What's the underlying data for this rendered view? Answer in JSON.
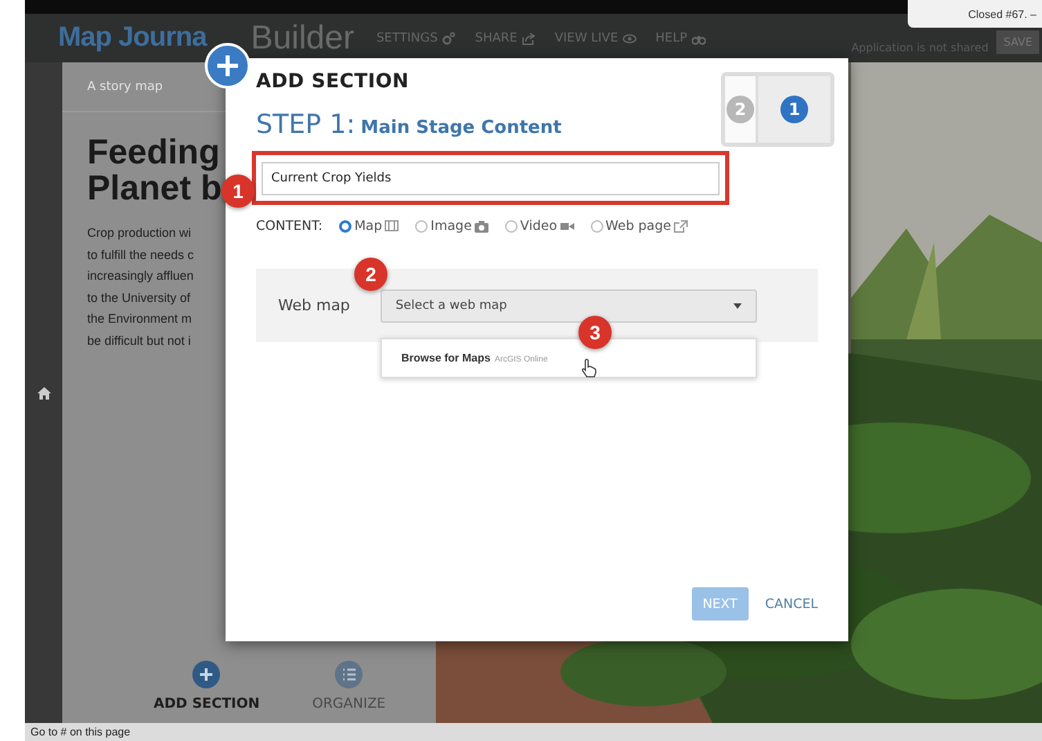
{
  "header": {
    "app_title": "Map Journa",
    "app_subtitle": "Builder",
    "menu": [
      {
        "label": "SETTINGS"
      },
      {
        "label": "SHARE"
      },
      {
        "label": "VIEW LIVE"
      },
      {
        "label": "HELP"
      }
    ],
    "status_text": "Application is not shared",
    "save_button": "SAVE"
  },
  "notification": {
    "text": "Closed #67. –"
  },
  "story_panel": {
    "subtitle": "A story map",
    "title_lines": [
      "Feeding",
      "Planet b"
    ],
    "body_lines": [
      "Crop production wi",
      "to fulfill the needs c",
      "increasingly affluen",
      "to the University of",
      "the Environment m",
      "be difficult but not i"
    ],
    "actions": [
      {
        "label": "ADD SECTION",
        "disabled": false
      },
      {
        "label": "ORGANIZE",
        "disabled": true
      }
    ]
  },
  "dialog": {
    "title": "ADD SECTION",
    "step_label": "STEP 1:",
    "step_title": "Main Stage Content",
    "layout_steps": [
      {
        "number": "2",
        "selected": false
      },
      {
        "number": "1",
        "selected": true
      }
    ],
    "title_field": {
      "value": "Current Crop Yields"
    },
    "content_label": "CONTENT:",
    "content_options": [
      {
        "label": "Map",
        "kind": "map",
        "selected": true
      },
      {
        "label": "Image",
        "selected": false
      },
      {
        "label": "Video",
        "kind": "video",
        "selected": false
      },
      {
        "label": "Web page",
        "kind": "webpage",
        "selected": false
      }
    ],
    "web_map_label": "Web map",
    "web_map_select": {
      "placeholder": "Select a web map"
    },
    "dropdown_items": [
      {
        "label": "Browse for Maps",
        "source": "ArcGIS Online"
      }
    ],
    "buttons": [
      {
        "label": "NEXT",
        "kind": "primary",
        "disabled": true
      },
      {
        "label": "CANCEL",
        "kind": "link",
        "disabled": false
      }
    ]
  },
  "annotations": [
    "1",
    "2",
    "3"
  ],
  "status_bar": "Go to # on this page"
}
